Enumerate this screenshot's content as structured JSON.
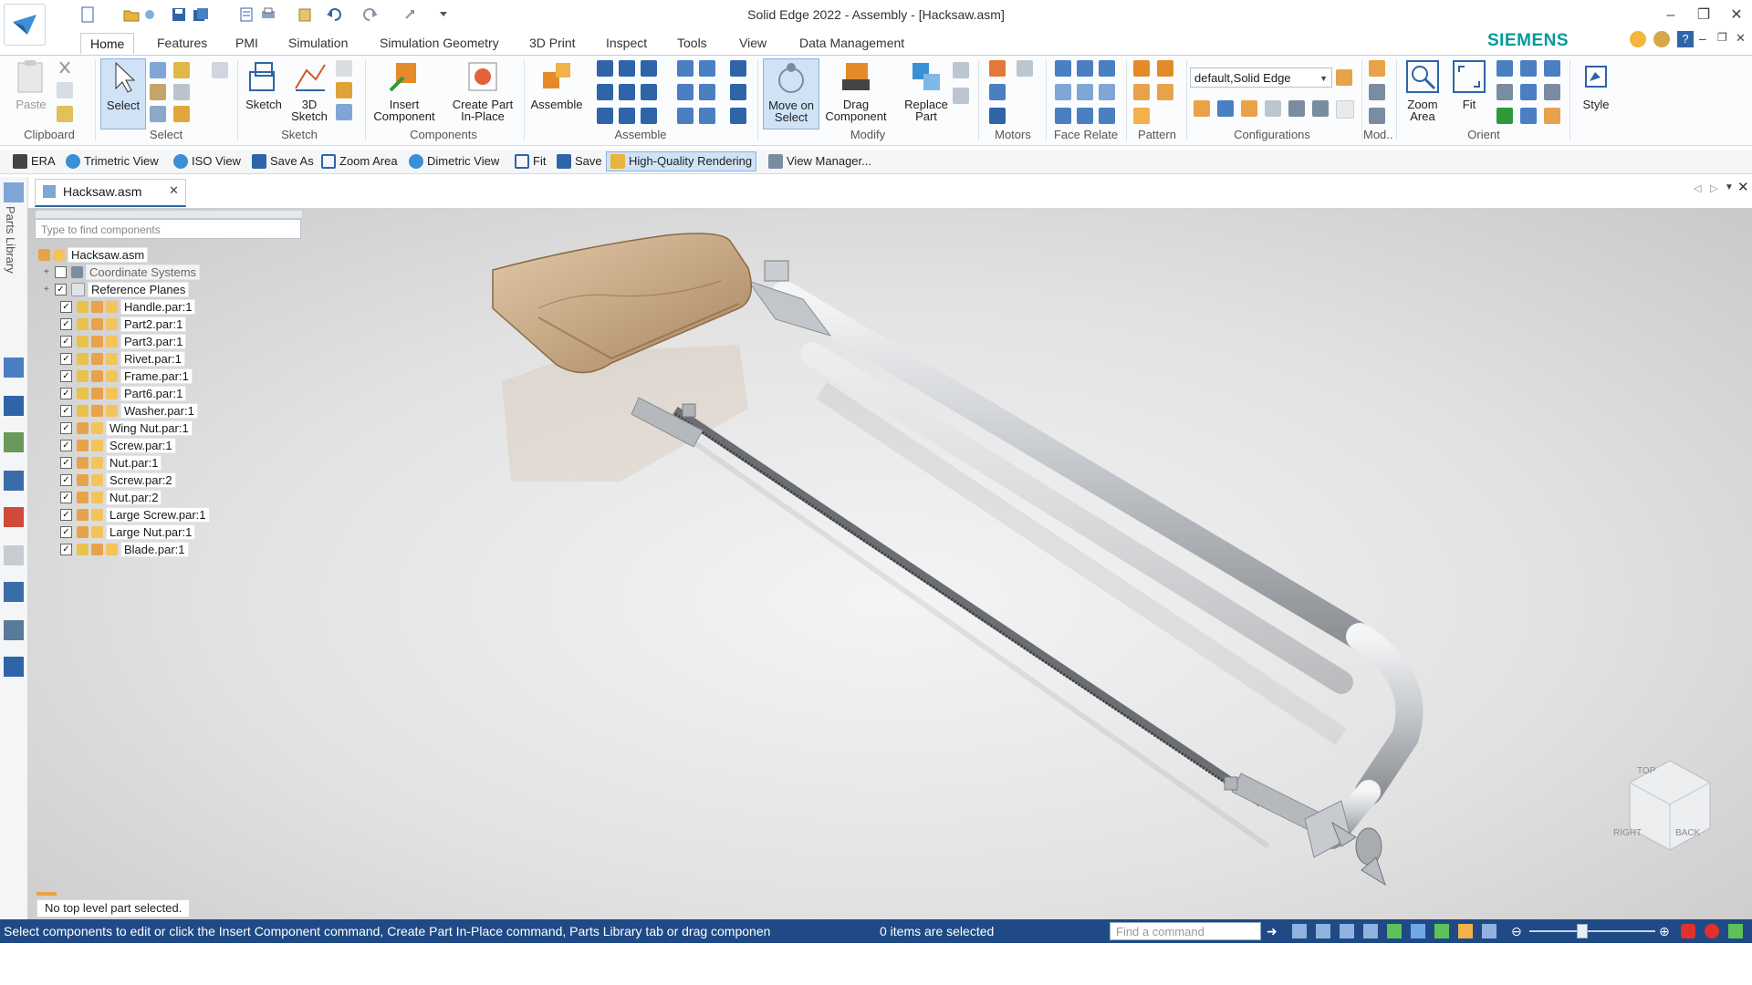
{
  "window": {
    "title": "Solid Edge 2022 - Assembly - [Hacksaw.asm]",
    "brand": "SIEMENS",
    "controls": [
      "–",
      "❐",
      "✕"
    ]
  },
  "tabs": [
    "Home",
    "Features",
    "PMI",
    "Simulation",
    "Simulation Geometry",
    "3D Print",
    "Inspect",
    "Tools",
    "View",
    "Data Management"
  ],
  "active_tab": "Home",
  "ribbon": {
    "buttons": {
      "paste": "Paste",
      "select": "Select",
      "sketch": "Sketch",
      "sketch3d_line1": "3D",
      "sketch3d_line2": "Sketch",
      "insert_comp_line1": "Insert",
      "insert_comp_line2": "Component",
      "create_part_line1": "Create Part",
      "create_part_line2": "In-Place",
      "assemble": "Assemble",
      "move_line1": "Move on",
      "move_line2": "Select",
      "drag_line1": "Drag",
      "drag_line2": "Component",
      "replace_line1": "Replace",
      "replace_line2": "Part",
      "zoom_line1": "Zoom",
      "zoom_line2": "Area",
      "fit": "Fit",
      "style": "Style"
    },
    "groups": [
      "Clipboard",
      "Select",
      "Sketch",
      "Components",
      "Assemble",
      "Modify",
      "Motors",
      "Face Relate",
      "Pattern",
      "Configurations",
      "Mod..",
      "Orient"
    ],
    "config_value": "default,Solid Edge"
  },
  "view_toolbar": [
    "ERA",
    "Trimetric View",
    "ISO View",
    "Save As",
    "Zoom Area",
    "Dimetric View",
    "Fit",
    "Save",
    "High-Quality Rendering",
    "View Manager..."
  ],
  "left_strip_label": "Parts Library",
  "document_tab": "Hacksaw.asm",
  "tree": {
    "search_placeholder": "Type to find components",
    "root": "Hacksaw.asm",
    "items": [
      {
        "label": "Coordinate Systems",
        "checked": false,
        "expand": true
      },
      {
        "label": "Reference Planes",
        "checked": true,
        "expand": true
      },
      {
        "label": "Handle.par:1",
        "checked": true
      },
      {
        "label": "Part2.par:1",
        "checked": true
      },
      {
        "label": "Part3.par:1",
        "checked": true
      },
      {
        "label": "Rivet.par:1",
        "checked": true
      },
      {
        "label": "Frame.par:1",
        "checked": true
      },
      {
        "label": "Part6.par:1",
        "checked": true
      },
      {
        "label": "Washer.par:1",
        "checked": true
      },
      {
        "label": "Wing Nut.par:1",
        "checked": true
      },
      {
        "label": "Screw.par:1",
        "checked": true
      },
      {
        "label": "Nut.par:1",
        "checked": true
      },
      {
        "label": "Screw.par:2",
        "checked": true
      },
      {
        "label": "Nut.par:2",
        "checked": true
      },
      {
        "label": "Large Screw.par:1",
        "checked": true
      },
      {
        "label": "Large Nut.par:1",
        "checked": true
      },
      {
        "label": "Blade.par:1",
        "checked": true
      }
    ]
  },
  "viewcube": {
    "top": "TOP",
    "right": "RIGHT",
    "back": "BACK"
  },
  "status": {
    "no_selection": "No top level part selected.",
    "prompt": "Select components to edit or click the Insert Component command, Create Part In-Place command, Parts Library tab or drag componen",
    "items_selected": "0 items are selected",
    "find_command_placeholder": "Find a command"
  },
  "colors": {
    "accent": "#1f4a86",
    "brand": "#009999",
    "handle": "#c8a27a",
    "frame": "#b9bcc0"
  }
}
